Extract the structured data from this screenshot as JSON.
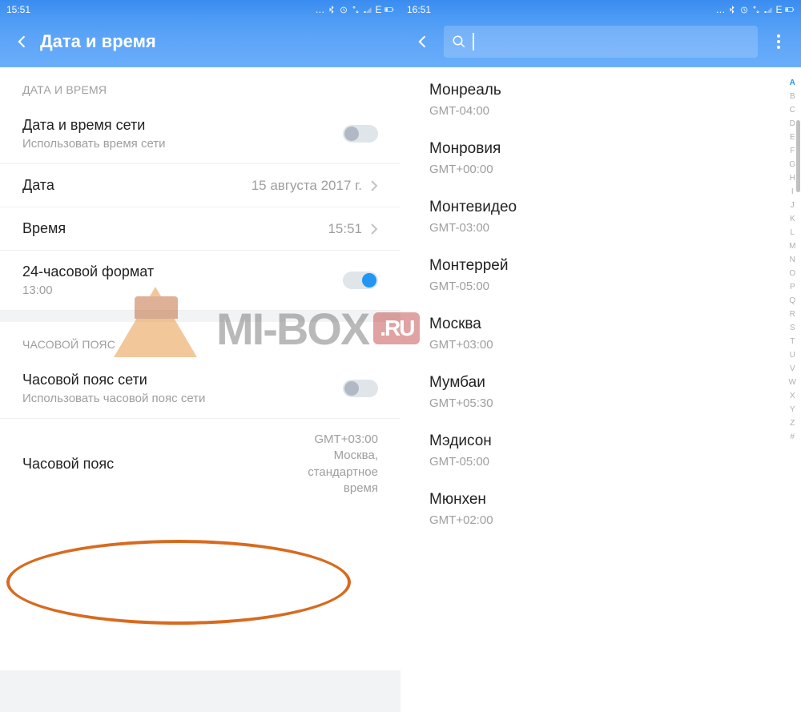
{
  "left": {
    "status_time": "15:51",
    "status_net": "E",
    "title": "Дата и время",
    "section1": "ДАТА И ВРЕМЯ",
    "network_time": {
      "label": "Дата и время сети",
      "sub": "Использовать время сети"
    },
    "date": {
      "label": "Дата",
      "value": "15 августа 2017 г."
    },
    "time": {
      "label": "Время",
      "value": "15:51"
    },
    "format24": {
      "label": "24-часовой формат",
      "sub": "13:00"
    },
    "section2": "ЧАСОВОЙ ПОЯС",
    "network_tz": {
      "label": "Часовой пояс сети",
      "sub": "Использовать часовой пояс сети"
    },
    "timezone": {
      "label": "Часовой пояс",
      "line1": "GMT+03:00",
      "line2": "Москва,",
      "line3": "стандартное",
      "line4": "время"
    }
  },
  "right": {
    "status_time": "16:51",
    "status_net": "E",
    "items": [
      {
        "city": "Монреаль",
        "gmt": "GMT-04:00"
      },
      {
        "city": "Монровия",
        "gmt": "GMT+00:00"
      },
      {
        "city": "Монтевидео",
        "gmt": "GMT-03:00"
      },
      {
        "city": "Монтеррей",
        "gmt": "GMT-05:00"
      },
      {
        "city": "Москва",
        "gmt": "GMT+03:00"
      },
      {
        "city": "Мумбаи",
        "gmt": "GMT+05:30"
      },
      {
        "city": "Мэдисон",
        "gmt": "GMT-05:00"
      },
      {
        "city": "Мюнхен",
        "gmt": "GMT+02:00"
      }
    ],
    "alpha": [
      "A",
      "B",
      "C",
      "D",
      "E",
      "F",
      "G",
      "H",
      "I",
      "J",
      "K",
      "L",
      "M",
      "N",
      "O",
      "P",
      "Q",
      "R",
      "S",
      "T",
      "U",
      "V",
      "W",
      "X",
      "Y",
      "Z",
      "#"
    ]
  },
  "watermark": "MI-BOX"
}
